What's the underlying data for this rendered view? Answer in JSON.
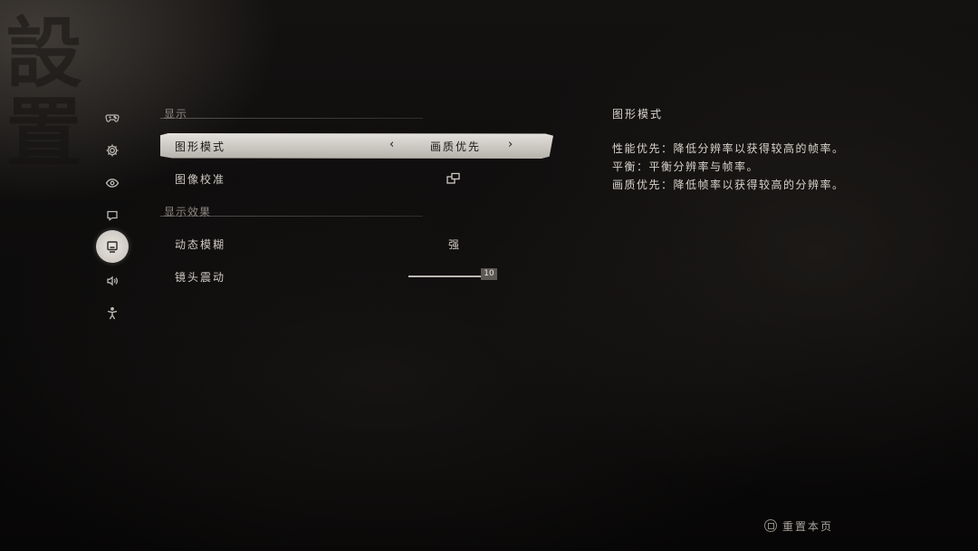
{
  "background_calligraphy": "設置",
  "rail": {
    "items": [
      {
        "icon": "gamepad-icon",
        "name": "rail-item-controls"
      },
      {
        "icon": "gear-icon",
        "name": "rail-item-general"
      },
      {
        "icon": "eye-icon",
        "name": "rail-item-visual"
      },
      {
        "icon": "subtitle-icon",
        "name": "rail-item-interface"
      },
      {
        "icon": "display-icon",
        "name": "rail-item-display",
        "active": true
      },
      {
        "icon": "speaker-icon",
        "name": "rail-item-audio"
      },
      {
        "icon": "accessibility-icon",
        "name": "rail-item-accessibility"
      }
    ]
  },
  "sections": {
    "display": {
      "title": "显示",
      "graphics_mode": {
        "label": "图形模式",
        "value": "画质优先"
      },
      "image_calibration": {
        "label": "图像校准"
      }
    },
    "display_effects": {
      "title": "显示效果",
      "motion_blur": {
        "label": "动态模糊",
        "value": "强"
      },
      "camera_shake": {
        "label": "镜头震动",
        "value": "10",
        "fraction": 1.0
      }
    }
  },
  "description": {
    "title": "图形模式",
    "lines": [
      "性能优先：降低分辨率以获得较高的帧率。",
      "平衡：平衡分辨率与帧率。",
      "画质优先：降低帧率以获得较高的分辨率。"
    ]
  },
  "footer": {
    "reset_label": "重置本页"
  },
  "colors": {
    "selected_row": "#d2cec8",
    "text": "#cfcac3",
    "active_rail": "#e4e1dc"
  }
}
